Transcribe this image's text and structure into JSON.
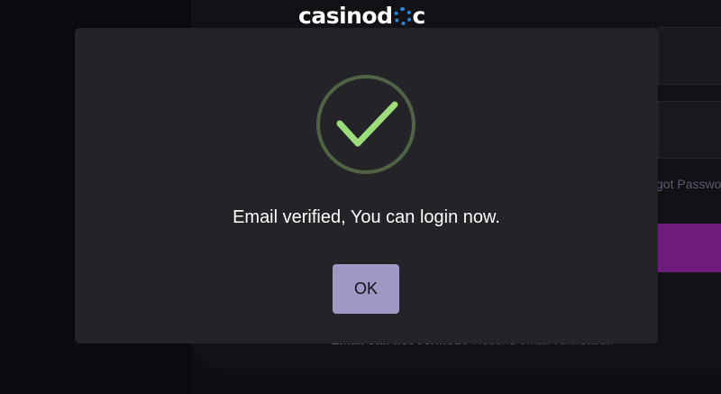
{
  "background": {
    "logo_text_left": "casinod",
    "logo_text_right": "c",
    "forgot_password_partial": "got Passwo",
    "verify_prefix": "Email still not verified?",
    "verify_link": "Resend email verification"
  },
  "modal": {
    "icon": "checkmark-success-icon",
    "message": "Email verified, You can login now.",
    "ok_label": "OK"
  },
  "colors": {
    "modal_bg": "#232328",
    "check": "#9ddc7d",
    "check_ring": "#4f6345",
    "ok_button": "#9d98c4",
    "login_button": "#6d1c7d",
    "logo_mark": "#2a86d8"
  }
}
